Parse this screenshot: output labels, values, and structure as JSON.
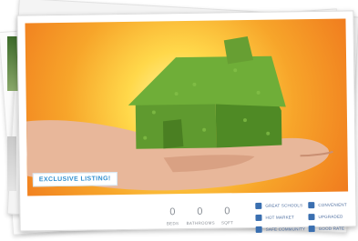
{
  "listing": {
    "badge": "EXCLUSIVE LISTING!",
    "stats": [
      {
        "value": "0",
        "label": "BEDS"
      },
      {
        "value": "0",
        "label": "BATHROOMS"
      },
      {
        "value": "0",
        "label": "SQFT"
      }
    ],
    "features": [
      {
        "label": "GREAT SCHOOLS",
        "icon": "school-icon"
      },
      {
        "label": "CONVENIENT",
        "icon": "car-icon"
      },
      {
        "label": "HOT MARKET",
        "icon": "chart-icon"
      },
      {
        "label": "UPGRADED",
        "icon": "upgrade-icon"
      },
      {
        "label": "SAFE COMMUNITY",
        "icon": "community-icon"
      },
      {
        "label": "GOOD RATE",
        "icon": "rate-icon"
      }
    ]
  },
  "colors": {
    "accent_blue": "#2f8fd0",
    "feature_text": "#4f6fa0",
    "icon_blue": "#3a6fb0",
    "grass_green": "#5f9a2f",
    "sun_yellow": "#ffd84a",
    "sun_orange": "#f07b1e"
  }
}
